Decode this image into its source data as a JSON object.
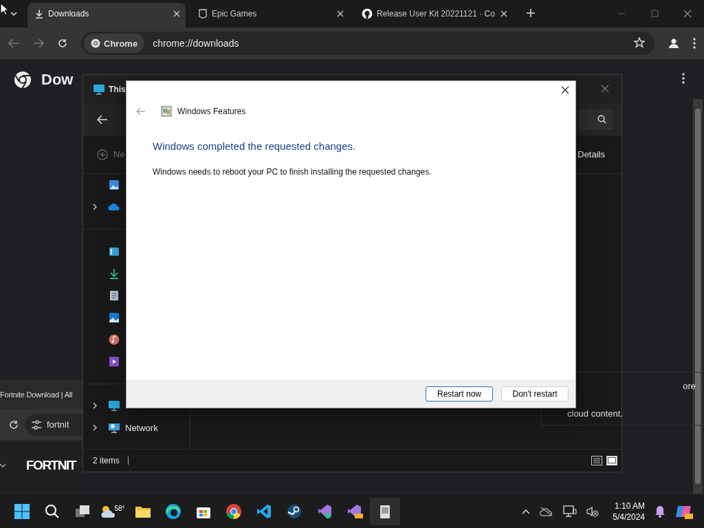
{
  "browser": {
    "tabs": [
      {
        "title": "Downloads",
        "selected": true
      },
      {
        "title": "Epic Games",
        "selected": false
      },
      {
        "title": "Release User Kit 20221121 · Co",
        "selected": false
      }
    ],
    "chip": "Chrome",
    "url": "chrome://downloads",
    "page_title": "Dow"
  },
  "back_browser": {
    "tab_title": "Fortnite Download | All",
    "url": "fortnit",
    "logo_text": "FORTNIT"
  },
  "explorer": {
    "title": "This",
    "new_label": "Ne",
    "view_label": "Details",
    "nav_groups": [
      [
        {
          "kind": "gallery",
          "expandable": false
        },
        {
          "kind": "cloud",
          "expandable": true
        }
      ],
      [
        {
          "kind": "desktop",
          "expandable": false
        },
        {
          "kind": "downloads",
          "expandable": false
        },
        {
          "kind": "documents",
          "expandable": false
        },
        {
          "kind": "pictures",
          "expandable": false
        },
        {
          "kind": "music",
          "expandable": false
        },
        {
          "kind": "videos",
          "expandable": false
        }
      ],
      [
        {
          "kind": "pc",
          "expandable": true
        },
        {
          "kind": "network",
          "label": "Network",
          "expandable": true
        }
      ]
    ],
    "panel_text": [
      "ore",
      "cloud content."
    ],
    "status": "2 items"
  },
  "dialog": {
    "title": "Windows Features",
    "heading": "Windows completed the requested changes.",
    "message": "Windows needs to reboot your PC to finish installing the requested changes.",
    "buttons": [
      {
        "label": "Restart now",
        "default": true
      },
      {
        "label": "Don't restart",
        "default": false
      }
    ]
  },
  "taskbar": {
    "weather": "58°",
    "time": "1:10 AM",
    "date": "5/4/2024"
  }
}
